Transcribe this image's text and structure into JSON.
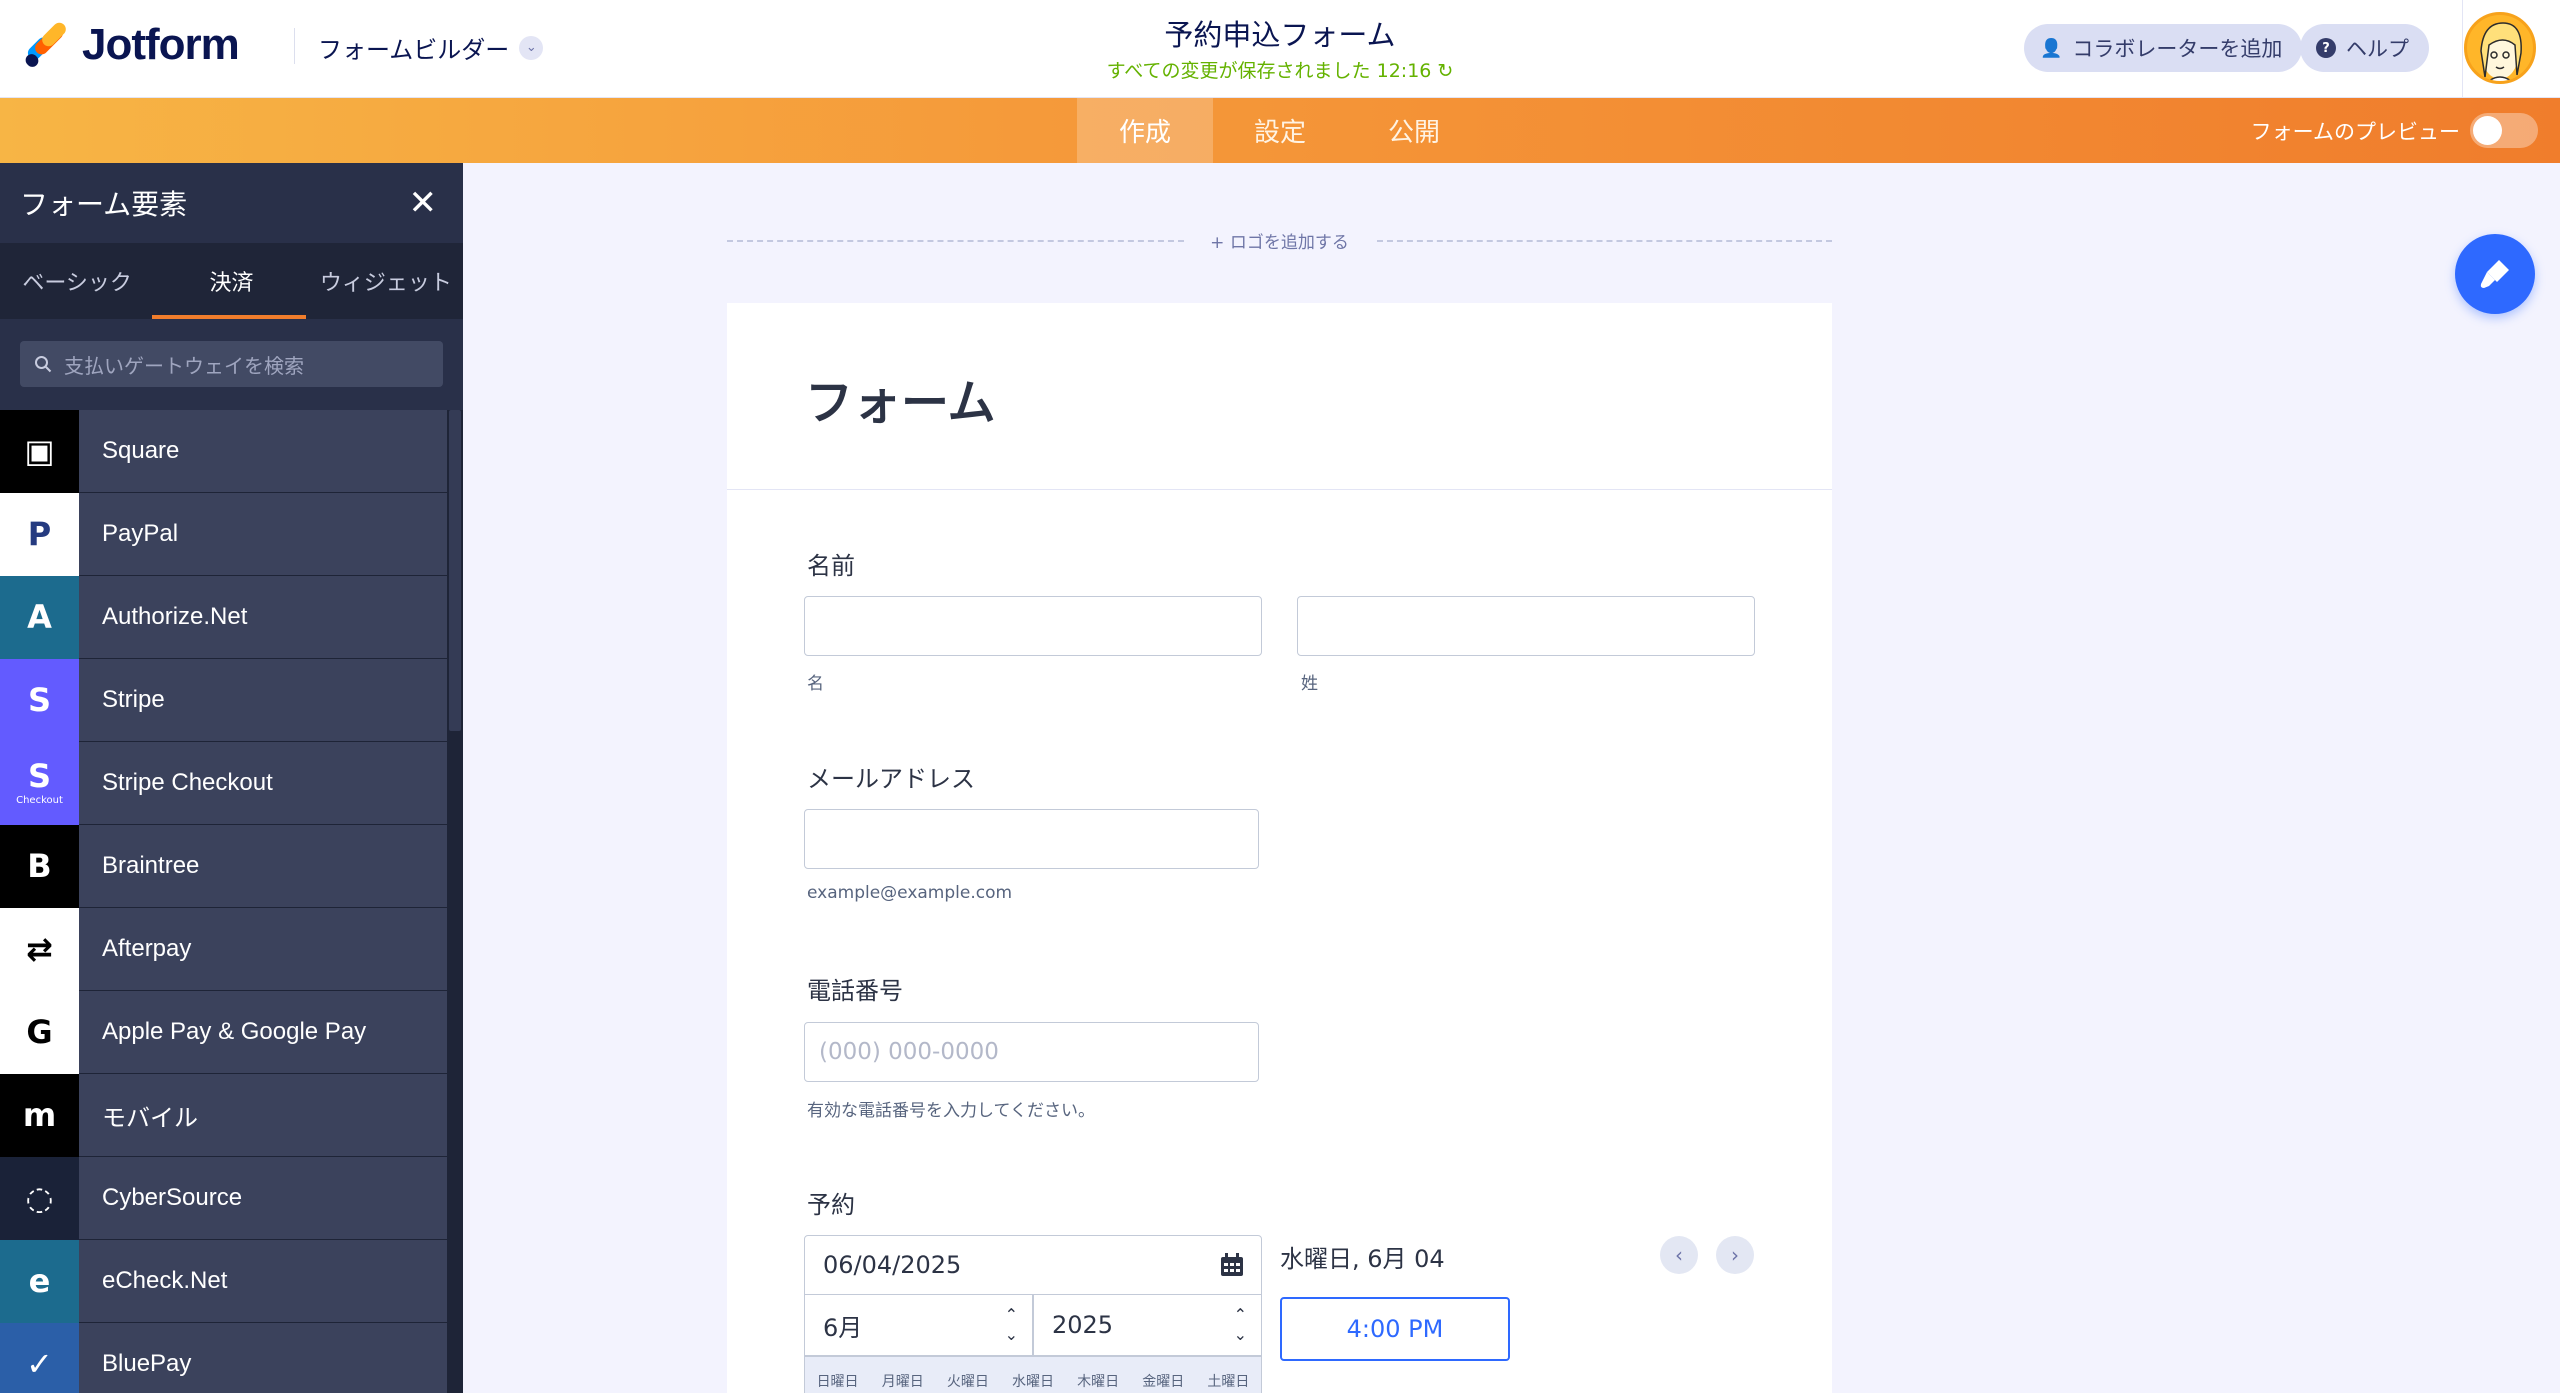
{
  "header": {
    "brand": "Jotform",
    "builder_label": "フォームビルダー",
    "form_title": "予約申込フォーム",
    "saved_status": "すべての変更が保存されました",
    "saved_time": "12:16",
    "add_collaborator": "コラボレーターを追加",
    "help": "ヘルプ"
  },
  "nav": {
    "tabs": [
      "作成",
      "設定",
      "公開"
    ],
    "active_tab": "作成",
    "preview_label": "フォームのプレビュー",
    "preview_enabled": false
  },
  "sidebar": {
    "title": "フォーム要素",
    "tabs": [
      "ベーシック",
      "決済",
      "ウィジェット"
    ],
    "active_tab": "決済",
    "search_placeholder": "支払いゲートウェイを検索",
    "items": [
      {
        "label": "Square",
        "icon": "square-logo-icon",
        "bg": "#000000",
        "fg": "#ffffff",
        "glyph": "▣"
      },
      {
        "label": "PayPal",
        "icon": "paypal-logo-icon",
        "bg": "#ffffff",
        "fg": "#253b80",
        "glyph": "P"
      },
      {
        "label": "Authorize.Net",
        "icon": "authorize-net-logo-icon",
        "bg": "#1c6b8e",
        "fg": "#ffffff",
        "glyph": "A"
      },
      {
        "label": "Stripe",
        "icon": "stripe-logo-icon",
        "bg": "#635bff",
        "fg": "#ffffff",
        "glyph": "S"
      },
      {
        "label": "Stripe Checkout",
        "icon": "stripe-checkout-logo-icon",
        "bg": "#635bff",
        "fg": "#ffffff",
        "glyph": "S",
        "sub": "Checkout"
      },
      {
        "label": "Braintree",
        "icon": "braintree-logo-icon",
        "bg": "#000000",
        "fg": "#ffffff",
        "glyph": "B"
      },
      {
        "label": "Afterpay",
        "icon": "afterpay-logo-icon",
        "bg": "#ffffff",
        "fg": "#000000",
        "glyph": "⇄"
      },
      {
        "label": "Apple Pay & Google Pay",
        "icon": "apple-google-pay-logo-icon",
        "bg": "#ffffff",
        "fg": "#000000",
        "glyph": "G"
      },
      {
        "label": "モバイル",
        "icon": "mollie-logo-icon",
        "bg": "#000000",
        "fg": "#ffffff",
        "glyph": "m"
      },
      {
        "label": "CyberSource",
        "icon": "cybersource-logo-icon",
        "bg": "#1a2238",
        "fg": "#ffffff",
        "glyph": "◌"
      },
      {
        "label": "eCheck.Net",
        "icon": "echeck-logo-icon",
        "bg": "#1c6b8e",
        "fg": "#ffffff",
        "glyph": "e"
      },
      {
        "label": "BluePay",
        "icon": "bluepay-logo-icon",
        "bg": "#2b5fa8",
        "fg": "#ffffff",
        "glyph": "✓"
      }
    ]
  },
  "canvas": {
    "add_logo": "+ ロゴを追加する",
    "form_heading": "フォーム",
    "fields": {
      "name_label": "名前",
      "first_name_sub": "名",
      "last_name_sub": "姓",
      "email_label": "メールアドレス",
      "email_sub": "example@example.com",
      "phone_label": "電話番号",
      "phone_placeholder": "(000) 000-0000",
      "phone_sub": "有効な電話番号を入力してください。",
      "appointment_label": "予約",
      "date_value": "06/04/2025",
      "month_value": "6月",
      "year_value": "2025",
      "selected_day": "水曜日, 6月 04",
      "time_slot": "4:00 PM",
      "weekdays": [
        "日曜日",
        "月曜日",
        "火曜日",
        "水曜日",
        "木曜日",
        "金曜日",
        "土曜日"
      ]
    }
  },
  "colors": {
    "accent_orange": "#f07d2c",
    "brand_navy": "#0a1551",
    "saved_green": "#64b200",
    "primary_blue": "#2e69ff"
  }
}
